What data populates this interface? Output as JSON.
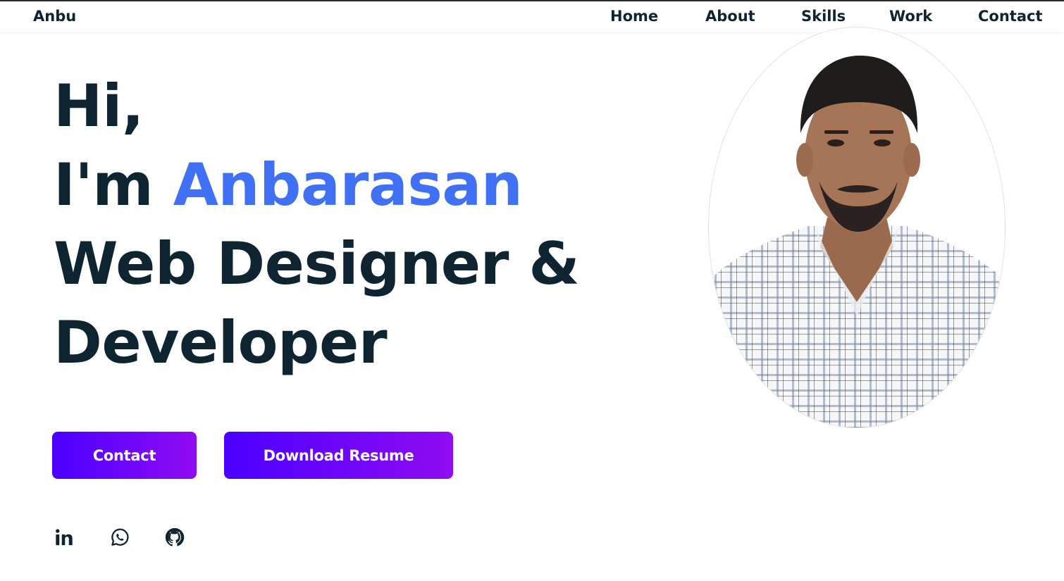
{
  "brand": {
    "logo": "Anbu"
  },
  "nav": {
    "items": [
      "Home",
      "About",
      "Skills",
      "Work",
      "Contact"
    ]
  },
  "hero": {
    "line1": "Hi,",
    "line2_prefix": "I'm ",
    "name": "Anbarasan",
    "line3": "Web Designer &",
    "line4": "Developer",
    "buttons": {
      "contact": "Contact",
      "resume": "Download Resume"
    }
  },
  "social": {
    "icons": [
      "linkedin-icon",
      "whatsapp-icon",
      "github-icon"
    ]
  },
  "colors": {
    "text": "#0e2431",
    "accent": "#4070f4",
    "button_start": "#4b00ff",
    "button_end": "#8f0cf0"
  }
}
